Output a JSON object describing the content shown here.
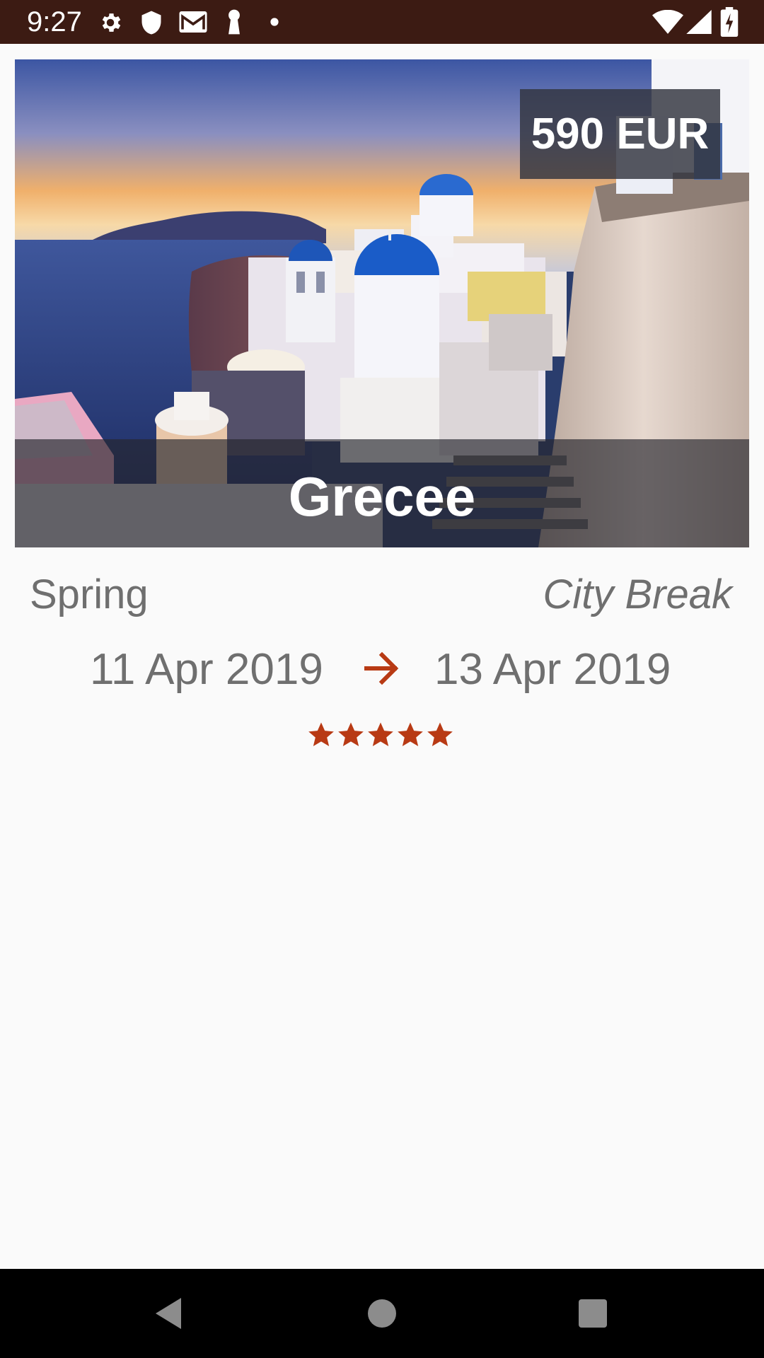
{
  "status_bar": {
    "time": "9:27",
    "left_icons": [
      "settings-icon",
      "shield-icon",
      "gmail-icon",
      "keyhole-icon",
      "dot-icon"
    ],
    "right_icons": [
      "wifi-icon",
      "cell-signal-icon",
      "battery-icon"
    ],
    "background": "#3c1b13"
  },
  "trip": {
    "price": "590 EUR",
    "destination": "Grecee",
    "season": "Spring",
    "trip_type": "City Break",
    "start_date": "11 Apr 2019",
    "end_date": "13 Apr 2019",
    "rating": 5,
    "rating_max": 5,
    "accent_color": "#b83a14"
  },
  "nav_bar": {
    "buttons": [
      "back-icon",
      "home-icon",
      "recents-icon"
    ]
  }
}
